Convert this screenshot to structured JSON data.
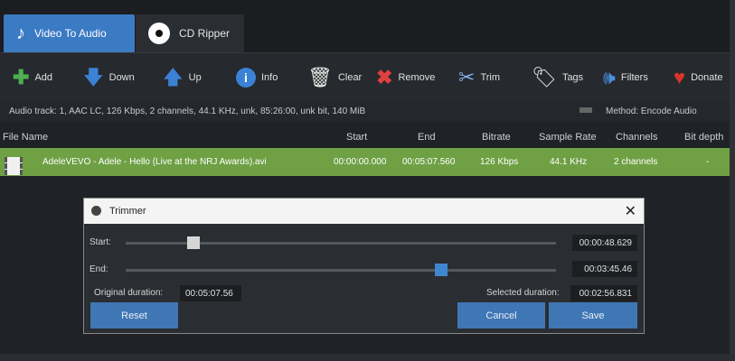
{
  "tabs": [
    {
      "label": "Video To Audio",
      "icon": "music-note-icon"
    },
    {
      "label": "CD Ripper",
      "icon": "cd-disc-icon"
    }
  ],
  "toolbar": {
    "add": "Add",
    "down": "Down",
    "up": "Up",
    "info": "Info",
    "clear": "Clear",
    "remove": "Remove",
    "trim": "Trim",
    "tags": "Tags",
    "filters": "Filters",
    "donate": "Donate"
  },
  "colors": {
    "accent": "#3b7bc4",
    "row_selected": "#6fa044",
    "add": "#4caf50",
    "remove": "#e04040",
    "donate": "#d9342b"
  },
  "track": {
    "label": "Audio track:",
    "value": "1, AAC LC, 126 Kbps, 2 channels, 44.1 KHz, unk, 85:26:00, unk bit, 140 MiB",
    "method_label": "Method:",
    "method_value": "Encode Audio"
  },
  "table": {
    "headers": [
      "File Name",
      "Start",
      "End",
      "Bitrate",
      "Sample Rate",
      "Channels",
      "Bit depth"
    ],
    "rows": [
      {
        "file": "AdeleVEVO - Adele - Hello (Live at the NRJ Awards).avi",
        "start": "00:00:00.000",
        "end": "00:05:07.560",
        "bitrate": "126 Kbps",
        "sample_rate": "44.1 KHz",
        "channels": "2 channels",
        "bit_depth": "-"
      }
    ]
  },
  "trimmer": {
    "title": "Trimmer",
    "start_label": "Start:",
    "start_value": "00:00:48.629",
    "end_label": "End:",
    "end_value": "00:03:45.46",
    "original_label": "Original duration:",
    "original_value": "00:05:07.56",
    "selected_label": "Selected duration:",
    "selected_value": "00:02:56.831",
    "reset": "Reset",
    "cancel": "Cancel",
    "save": "Save",
    "start_fraction": 0.158,
    "end_fraction": 0.733
  }
}
